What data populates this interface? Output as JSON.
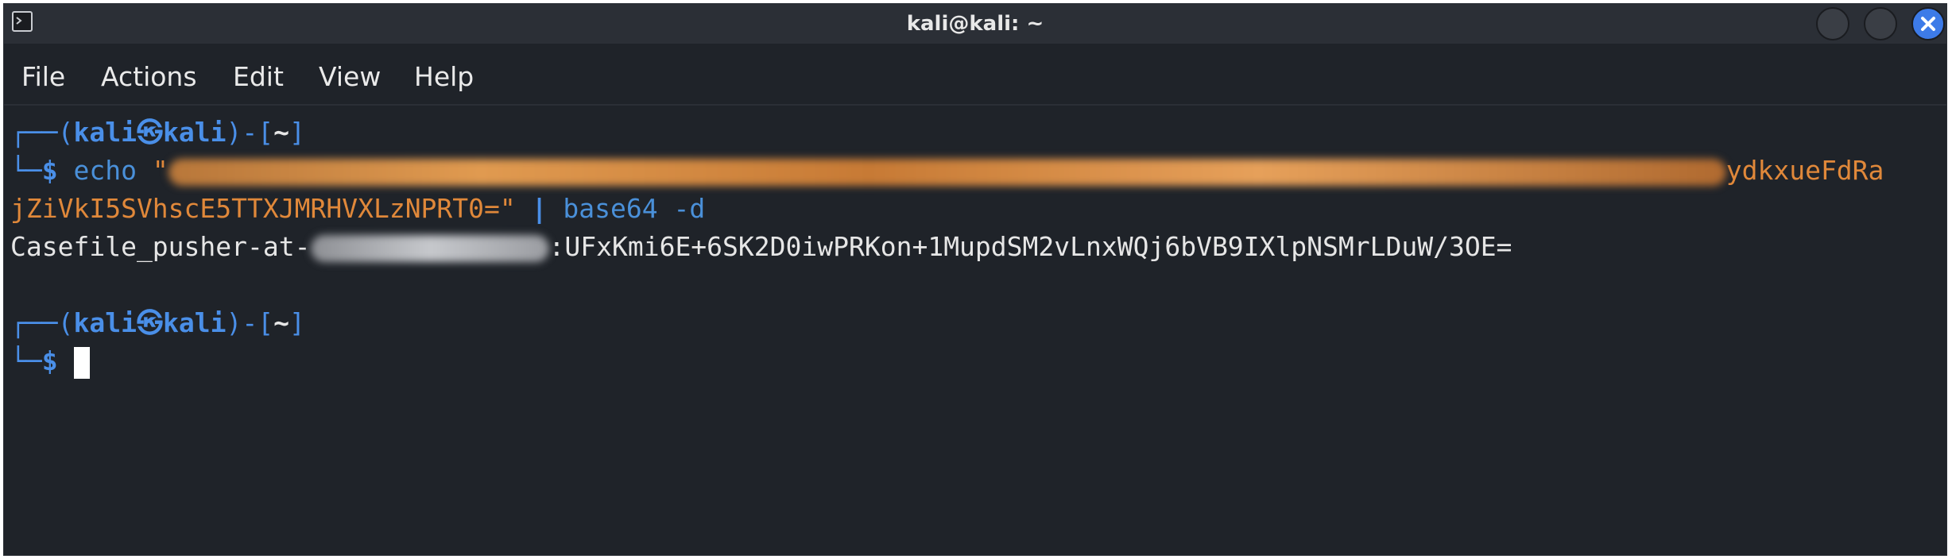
{
  "window": {
    "title": "kali@kali: ~"
  },
  "menu": {
    "file": "File",
    "actions": "Actions",
    "edit": "Edit",
    "view": "View",
    "help": "Help"
  },
  "prompt": {
    "open": "┌──(",
    "user": "kali",
    "at_symbol": "㉿",
    "host": "kali",
    "close": ")-[",
    "dir": "~",
    "end": "]",
    "corner": "└─",
    "dollar": "$"
  },
  "command": {
    "echo": "echo",
    "quote_open": "\"",
    "visible_tail_line1": "ydkxueFdRa",
    "line2": "jZiVkI5SVhscE5TTXJMRHVXLzNPRT0=\"",
    "pipe": "|",
    "base64": "base64",
    "flag": "-d"
  },
  "output": {
    "prefix": "Casefile_pusher-at-",
    "secret": ":UFxKmi6E+6SK2D0iwPRKon+1MupdSM2vLnxWQj6bVB9IXlpNSMrLDuW/3OE="
  },
  "colors": {
    "background": "#1f2329",
    "prompt_blue": "#4a8fe8",
    "string_orange": "#e0883a",
    "text": "#e6e6e6",
    "close_button": "#3d7be8"
  }
}
